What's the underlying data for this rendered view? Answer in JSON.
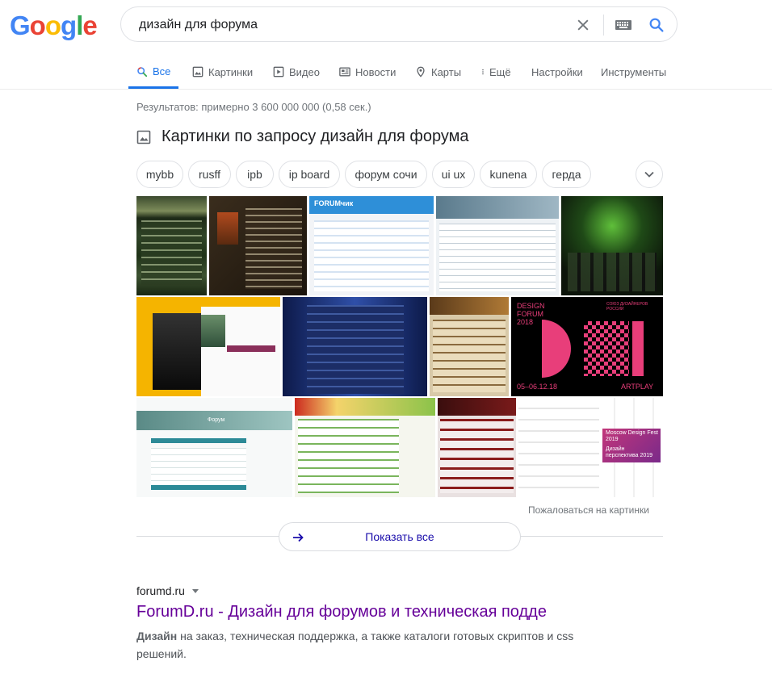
{
  "logo": [
    "G",
    "o",
    "o",
    "g",
    "l",
    "e"
  ],
  "search": {
    "query": "дизайн для форума"
  },
  "tabs": [
    {
      "label": "Все",
      "icon": "search-icon"
    },
    {
      "label": "Картинки",
      "icon": "image-icon"
    },
    {
      "label": "Видео",
      "icon": "play-icon"
    },
    {
      "label": "Новости",
      "icon": "news-icon"
    },
    {
      "label": "Карты",
      "icon": "map-pin-icon"
    },
    {
      "label": "Ещё",
      "icon": "more-vert-icon"
    },
    {
      "label": "Настройки"
    },
    {
      "label": "Инструменты"
    }
  ],
  "stats": "Результатов: примерно 3 600 000 000 (0,58 сек.)",
  "images": {
    "heading": "Картинки по запросу дизайн для форума",
    "chips": [
      "mybb",
      "rusff",
      "ipb",
      "ip board",
      "форум сочи",
      "ui ux",
      "kunena",
      "герда"
    ],
    "thumb_texts": {
      "forumchik": "FORUMчик",
      "design_forum": "DESIGN FORUM 2018",
      "design_forum_date": "05–06.12.18",
      "artplay": "ARTPLAY",
      "soyuz": "СОЮЗ ДИЗАЙНЕРОВ РОССИИ",
      "forum": "Форум",
      "moscow": "Moscow Design Fest 2019",
      "dizain": "Дизайн перспектива 2019"
    },
    "report": "Пожаловаться на картинки",
    "show_all": "Показать все"
  },
  "result": {
    "cite": "forumd.ru",
    "title": "ForumD.ru - Дизайн для форумов и техническая подде",
    "snippet_bold": "Дизайн",
    "snippet": " на заказ, техническая поддержка, а также каталоги готовых скриптов и css решений."
  },
  "colors": {
    "blue": "#4285f4",
    "red": "#ea4335",
    "yellow": "#fbbc05",
    "green": "#34a853",
    "active_tab": "#1a73e8",
    "visited": "#660099",
    "link": "#1a0dab"
  }
}
